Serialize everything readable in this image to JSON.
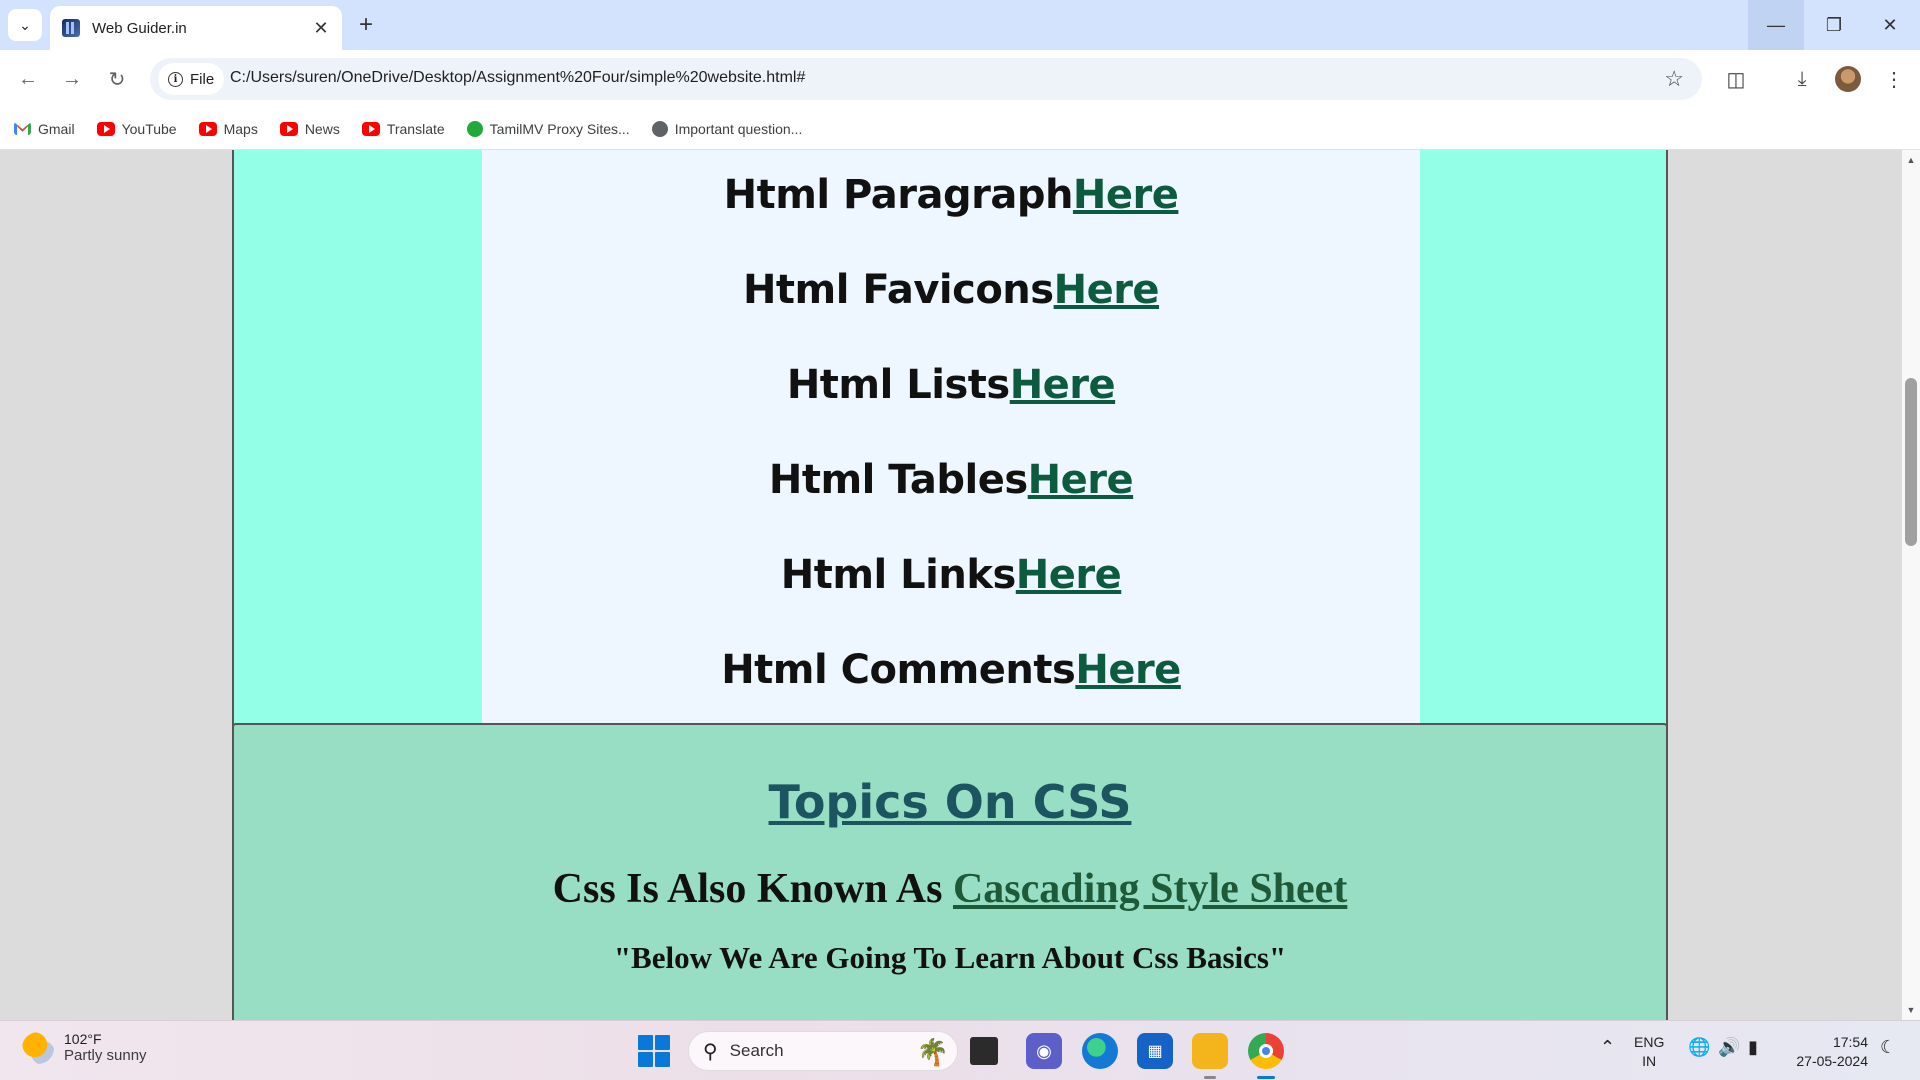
{
  "browser": {
    "tab_title": "Web Guider.in",
    "new_tab_label": "+",
    "site_chip": "File",
    "url": "C:/Users/suren/OneDrive/Desktop/Assignment%20Four/simple%20website.html#"
  },
  "bookmarks": [
    {
      "label": "Gmail",
      "icon": "gmail-icon"
    },
    {
      "label": "YouTube",
      "icon": "youtube-icon"
    },
    {
      "label": "Maps",
      "icon": "youtube-icon"
    },
    {
      "label": "News",
      "icon": "youtube-icon"
    },
    {
      "label": "Translate",
      "icon": "youtube-icon"
    },
    {
      "label": "TamilMV Proxy Sites...",
      "icon": "green-circle-icon"
    },
    {
      "label": "Important question...",
      "icon": "globe-icon"
    }
  ],
  "html_topics": [
    {
      "label": "Html Paragraph",
      "link": "Here"
    },
    {
      "label": "Html Favicons",
      "link": "Here"
    },
    {
      "label": "Html Lists",
      "link": "Here"
    },
    {
      "label": "Html Tables",
      "link": "Here"
    },
    {
      "label": "Html Links",
      "link": "Here"
    },
    {
      "label": "Html Comments",
      "link": "Here"
    }
  ],
  "css_section": {
    "title": "Topics On CSS",
    "subtitle_prefix": "Css Is Also Known As ",
    "subtitle_link": "Cascading Style Sheet",
    "quote": "\"Below We Are Going To Learn About Css Basics\""
  },
  "taskbar": {
    "weather_temp": "102°F",
    "weather_desc": "Partly sunny",
    "search_placeholder": "Search",
    "lang_line1": "ENG",
    "lang_line2": "IN",
    "time": "17:54",
    "date": "27-05-2024"
  },
  "colors": {
    "html_section_bg": "#93ffe6",
    "html_card_bg": "#eef7ff",
    "css_section_bg": "#98dec4",
    "link_color": "#0d5b3f"
  }
}
